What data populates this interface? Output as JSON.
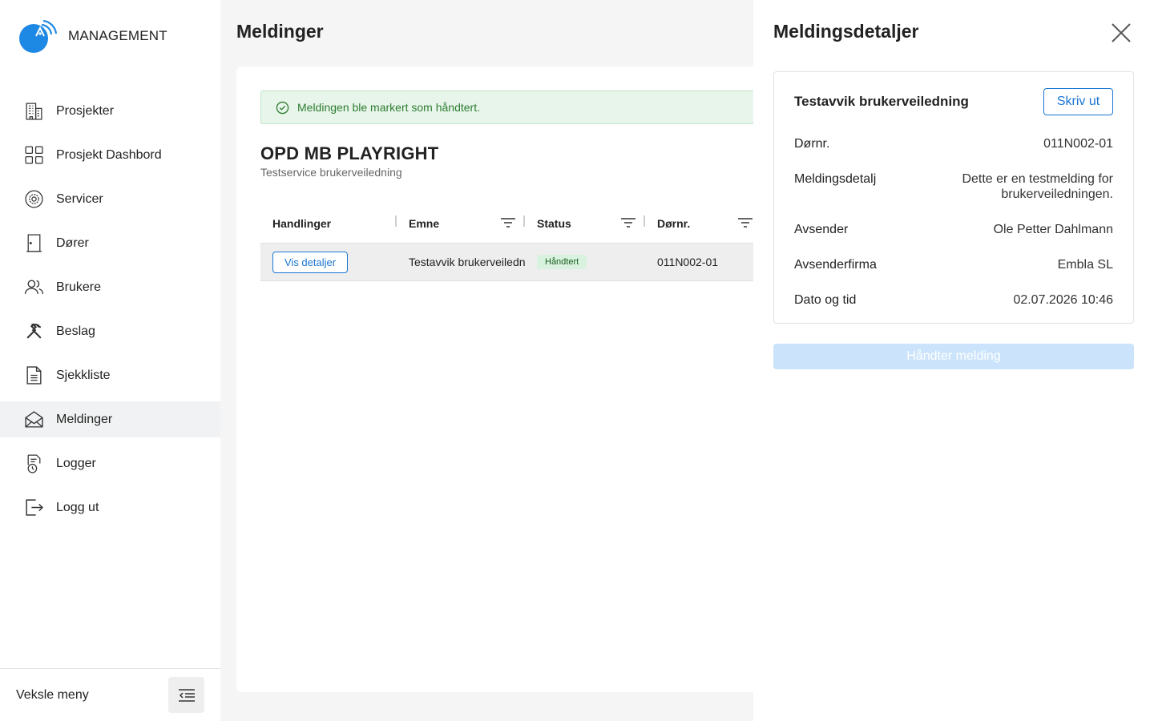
{
  "app": {
    "brand": "MANAGEMENT"
  },
  "sidebar": {
    "items": [
      {
        "label": "Prosjekter",
        "icon": "building-icon"
      },
      {
        "label": "Prosjekt Dashbord",
        "icon": "dashboard-grid-icon"
      },
      {
        "label": "Servicer",
        "icon": "service-gear-icon"
      },
      {
        "label": "Dører",
        "icon": "door-icon"
      },
      {
        "label": "Brukere",
        "icon": "users-icon"
      },
      {
        "label": "Beslag",
        "icon": "tools-icon"
      },
      {
        "label": "Sjekkliste",
        "icon": "document-icon"
      },
      {
        "label": "Meldinger",
        "icon": "envelope-open-icon",
        "active": true
      },
      {
        "label": "Logger",
        "icon": "log-clock-icon"
      },
      {
        "label": "Logg ut",
        "icon": "logout-icon"
      }
    ],
    "footer_label": "Veksle meny"
  },
  "main": {
    "title": "Meldinger",
    "alert": "Meldingen ble markert som håndtert.",
    "project_title": "OPD MB PLAYRIGHT",
    "project_subtitle": "Testservice brukerveiledning",
    "table": {
      "columns": [
        "Handlinger",
        "Emne",
        "Status",
        "Dørnr."
      ],
      "rows": [
        {
          "action": "Vis detaljer",
          "subject": "Testavvik brukerveiledn",
          "status": "Håndtert",
          "door": "011N002-01"
        }
      ]
    }
  },
  "drawer": {
    "title": "Meldingsdetaljer",
    "card_title": "Testavvik brukerveiledning",
    "print_label": "Skriv ut",
    "fields": [
      {
        "key": "Dørnr.",
        "value": "011N002-01"
      },
      {
        "key": "Meldingsdetalj",
        "value": "Dette er en testmelding for brukerveiledningen."
      },
      {
        "key": "Avsender",
        "value": "Ole Petter Dahlmann"
      },
      {
        "key": "Avsenderfirma",
        "value": "Embla SL"
      },
      {
        "key": "Dato og tid",
        "value": "02.07.2026 10:46"
      }
    ],
    "handle_label": "Håndter melding"
  },
  "colors": {
    "accent": "#1976d2",
    "success_bg": "#e8f5ea",
    "success_text": "#2e7d32",
    "disabled_button": "#cce4fb"
  }
}
